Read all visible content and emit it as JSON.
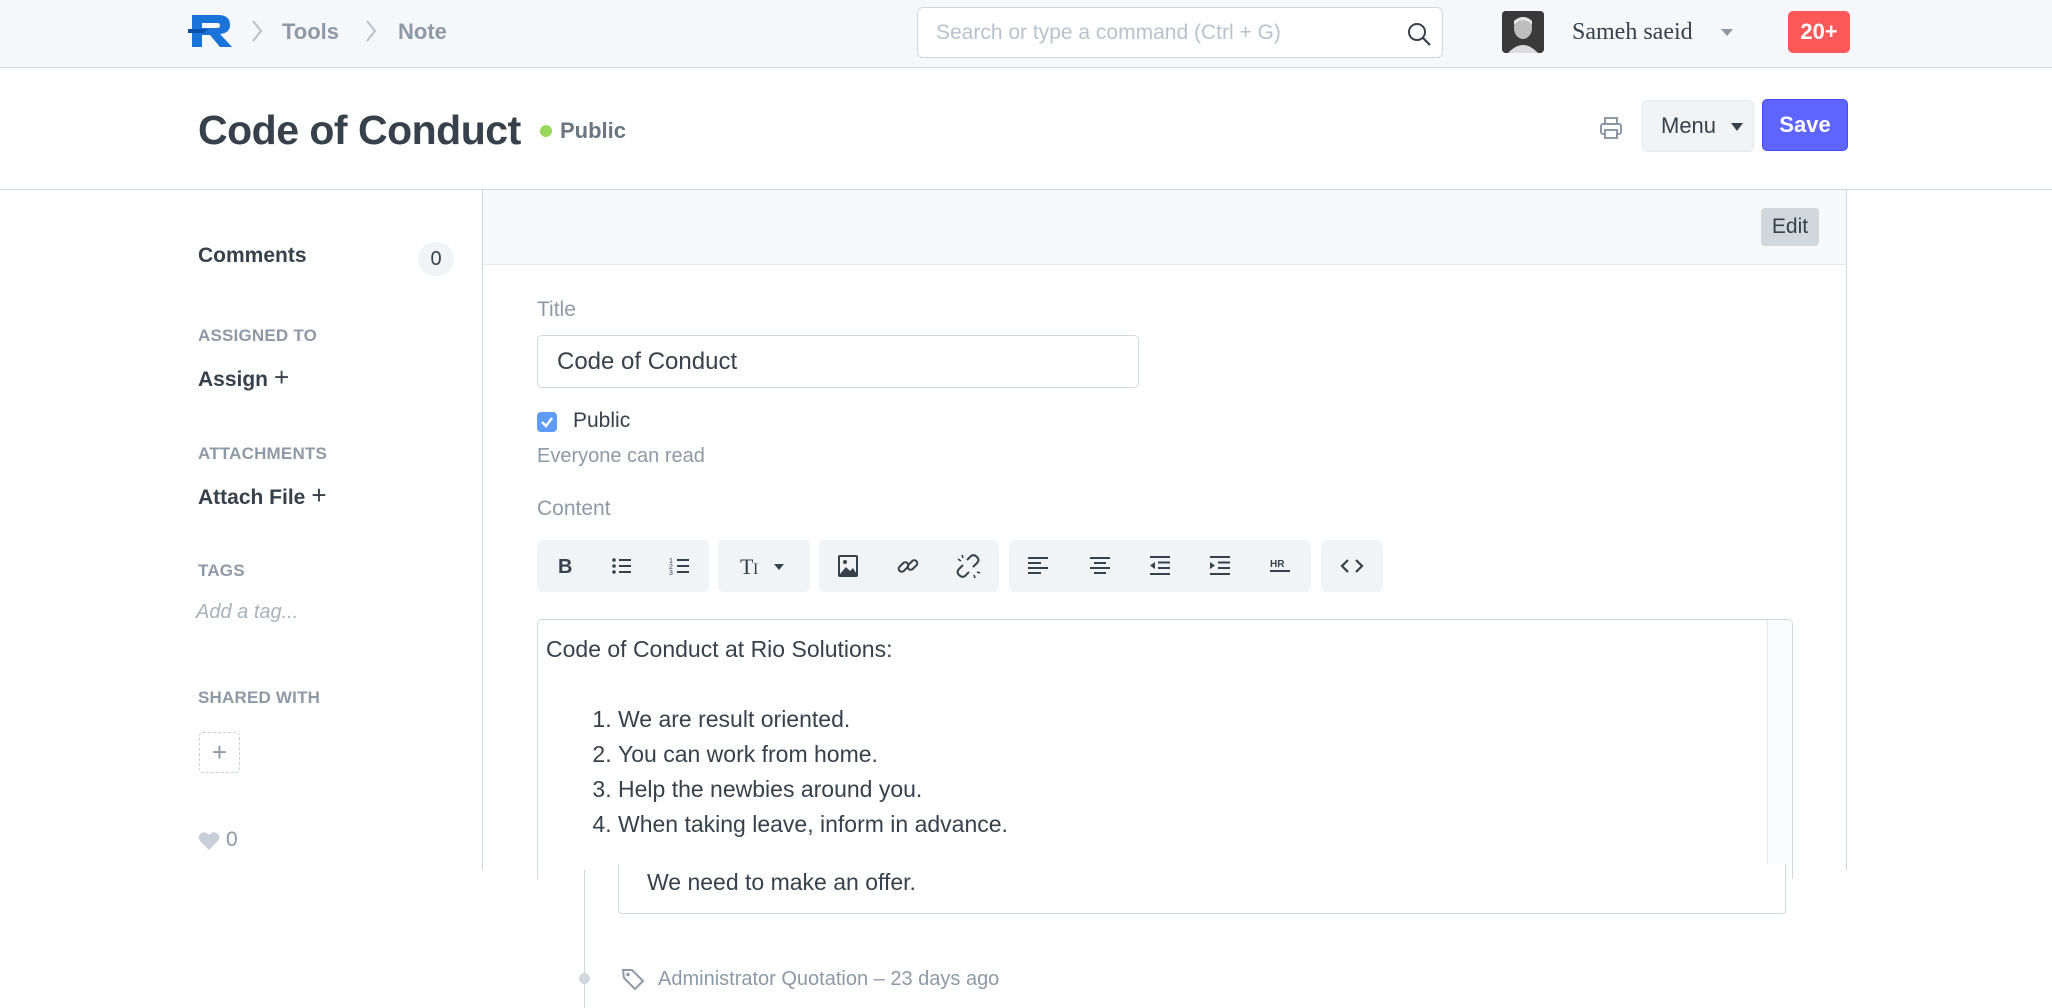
{
  "navbar": {
    "breadcrumbs": [
      "Tools",
      "Note"
    ],
    "search_placeholder": "Search or type a command (Ctrl + G)",
    "user_name": "Sameh saeid",
    "notifications": "20+"
  },
  "page": {
    "title": "Code of Conduct",
    "status": "Public",
    "menu_label": "Menu",
    "save_label": "Save"
  },
  "sidebar": {
    "comments_label": "Comments",
    "comments_count": "0",
    "assigned_to_heading": "ASSIGNED TO",
    "assign_label": "Assign",
    "attachments_heading": "ATTACHMENTS",
    "attach_label": "Attach File",
    "tags_heading": "TAGS",
    "tag_placeholder": "Add a tag...",
    "shared_heading": "SHARED WITH",
    "likes": "0"
  },
  "form": {
    "edit_label": "Edit",
    "title_label": "Title",
    "title_value": "Code of Conduct",
    "public_label": "Public",
    "public_checked": true,
    "public_help": "Everyone can read",
    "content_label": "Content",
    "content_intro": "Code of Conduct at Rio Solutions:",
    "content_items": [
      "We are result oriented.",
      "You can work from home.",
      "Help the newbies around you.",
      "When taking leave, inform in advance."
    ]
  },
  "timeline": {
    "comment": "We need to make an offer.",
    "entry": "Administrator Quotation – 23 days ago"
  },
  "colors": {
    "primary": "#5e64ff",
    "badge": "#ff5858",
    "status_public": "#98d85b",
    "checkbox": "#5e9cf7"
  },
  "icons": [
    "logo-icon",
    "search-icon",
    "caret-down-icon",
    "print-icon",
    "bold-icon",
    "bullet-list-icon",
    "ordered-list-icon",
    "text-size-icon",
    "image-icon",
    "link-icon",
    "unlink-icon",
    "align-left-icon",
    "align-center-icon",
    "outdent-icon",
    "indent-icon",
    "hr-icon",
    "code-icon",
    "heart-icon",
    "tag-icon"
  ]
}
